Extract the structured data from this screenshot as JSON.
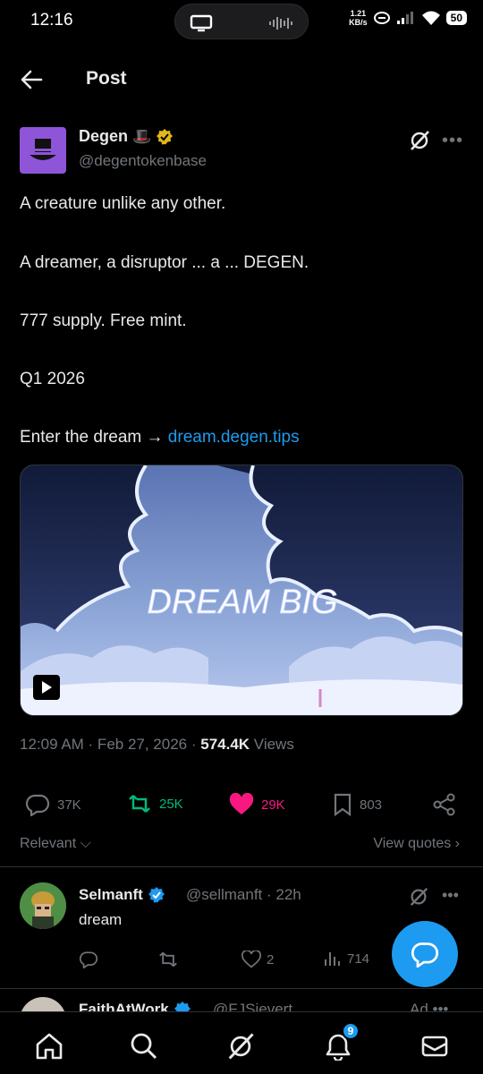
{
  "status_bar": {
    "time": "12:16",
    "speed_value": "1.21",
    "speed_unit": "KB/s",
    "battery": "50"
  },
  "header": {
    "title": "Post",
    "back_icon": "arrow-left-icon"
  },
  "post": {
    "author_name": "Degen",
    "author_emoji": "🎩",
    "author_handle": "@degentokenbase",
    "lines": {
      "l1": "A creature unlike any other.",
      "l2": "A dreamer, a disruptor ... a ... DEGEN.",
      "l3": "777 supply. Free mint.",
      "l4": "Q1 2026",
      "l5_prefix": "Enter the dream → ",
      "l5_link": "dream.degen.tips"
    },
    "media_text": "DREAM BIG",
    "meta": {
      "time": "12:09 AM · Feb 27, 2026 · ",
      "views_count": "574.4K",
      "views_label": " Views"
    },
    "actions": {
      "replies": "37K",
      "reposts": "25K",
      "likes": "29K",
      "bookmarks": "803"
    },
    "colors": {
      "repost": "#00ba7c",
      "like": "#f91880",
      "link": "#1d9bf0"
    }
  },
  "sort": {
    "relevant_label": "Relevant",
    "view_quotes_label": "View quotes"
  },
  "reply": {
    "name": "Selmanft",
    "handle": "@sellmanft · 22h",
    "text": "dream",
    "likes": "2",
    "views": "714"
  },
  "next_reply": {
    "name": "FaithAtWork",
    "handle": "@FJSievert",
    "ad": "Ad"
  },
  "bottom_nav": {
    "items": [
      "home-icon",
      "search-icon",
      "grok-icon",
      "notifications-icon",
      "messages-icon"
    ],
    "notifications_badge": "9"
  }
}
